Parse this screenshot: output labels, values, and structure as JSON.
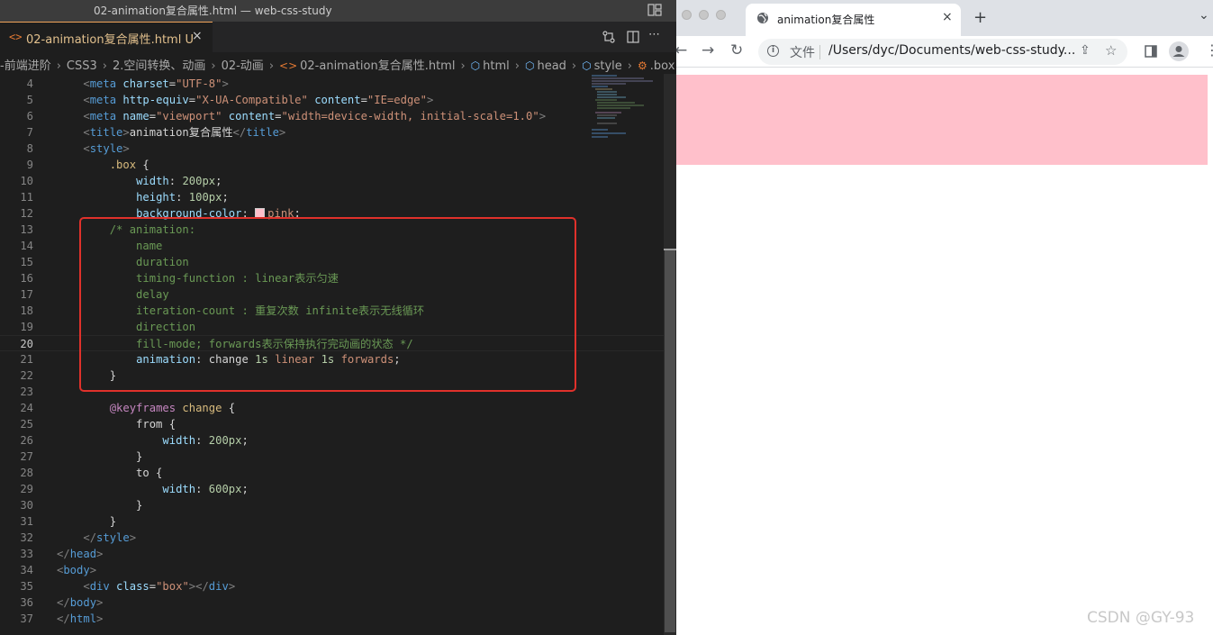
{
  "vscode": {
    "window_title": "02-animation复合属性.html — web-css-study",
    "tab": {
      "icon": "<>",
      "name": "02-animation复合属性.html",
      "status": "U",
      "close": "×"
    },
    "breadcrumb": [
      "-前端进阶",
      "CSS3",
      "2.空间转换、动画",
      "02-动画",
      "02-animation复合属性.html",
      "html",
      "head",
      "style",
      ".box"
    ],
    "code_lines": [
      {
        "n": "4",
        "code": [
          [
            "    ",
            "txt"
          ],
          [
            "<",
            "tg"
          ],
          [
            "meta",
            "tn"
          ],
          [
            " charset",
            "an"
          ],
          [
            "=",
            "txt"
          ],
          [
            "\"UTF-8\"",
            "av"
          ],
          [
            ">",
            "tg"
          ]
        ]
      },
      {
        "n": "5",
        "code": [
          [
            "    ",
            "txt"
          ],
          [
            "<",
            "tg"
          ],
          [
            "meta",
            "tn"
          ],
          [
            " http-equiv",
            "an"
          ],
          [
            "=",
            "txt"
          ],
          [
            "\"X-UA-Compatible\"",
            "av"
          ],
          [
            " content",
            "an"
          ],
          [
            "=",
            "txt"
          ],
          [
            "\"IE=edge\"",
            "av"
          ],
          [
            ">",
            "tg"
          ]
        ]
      },
      {
        "n": "6",
        "code": [
          [
            "    ",
            "txt"
          ],
          [
            "<",
            "tg"
          ],
          [
            "meta",
            "tn"
          ],
          [
            " name",
            "an"
          ],
          [
            "=",
            "txt"
          ],
          [
            "\"viewport\"",
            "av"
          ],
          [
            " content",
            "an"
          ],
          [
            "=",
            "txt"
          ],
          [
            "\"width=device-width, initial-scale=1.0\"",
            "av"
          ],
          [
            ">",
            "tg"
          ]
        ]
      },
      {
        "n": "7",
        "code": [
          [
            "    ",
            "txt"
          ],
          [
            "<",
            "tg"
          ],
          [
            "title",
            "tn"
          ],
          [
            ">",
            "tg"
          ],
          [
            "animation复合属性",
            "txt"
          ],
          [
            "</",
            "tg"
          ],
          [
            "title",
            "tn"
          ],
          [
            ">",
            "tg"
          ]
        ]
      },
      {
        "n": "8",
        "code": [
          [
            "    ",
            "txt"
          ],
          [
            "<",
            "tg"
          ],
          [
            "style",
            "tn"
          ],
          [
            ">",
            "tg"
          ]
        ]
      },
      {
        "n": "9",
        "code": [
          [
            "        ",
            "txt"
          ],
          [
            ".box",
            "sel"
          ],
          [
            " {",
            "txt"
          ]
        ]
      },
      {
        "n": "10",
        "code": [
          [
            "            ",
            "txt"
          ],
          [
            "width",
            "prop"
          ],
          [
            ": ",
            "txt"
          ],
          [
            "200px",
            "num"
          ],
          [
            ";",
            "txt"
          ]
        ]
      },
      {
        "n": "11",
        "code": [
          [
            "            ",
            "txt"
          ],
          [
            "height",
            "prop"
          ],
          [
            ": ",
            "txt"
          ],
          [
            "100px",
            "num"
          ],
          [
            ";",
            "txt"
          ]
        ]
      },
      {
        "n": "12",
        "code": [
          [
            "            ",
            "txt"
          ],
          [
            "background-color",
            "prop"
          ],
          [
            ": ",
            "txt"
          ],
          [
            "SWATCH",
            "swatch"
          ],
          [
            "pink",
            "av"
          ],
          [
            ";",
            "txt"
          ]
        ]
      },
      {
        "n": "13",
        "code": [
          [
            "        ",
            "txt"
          ],
          [
            "/* animation:",
            "cm"
          ]
        ]
      },
      {
        "n": "14",
        "code": [
          [
            "            name",
            "cm"
          ]
        ]
      },
      {
        "n": "15",
        "code": [
          [
            "            duration",
            "cm"
          ]
        ]
      },
      {
        "n": "16",
        "code": [
          [
            "            timing-function : linear表示匀速",
            "cm"
          ]
        ]
      },
      {
        "n": "17",
        "code": [
          [
            "            delay",
            "cm"
          ]
        ]
      },
      {
        "n": "18",
        "code": [
          [
            "            iteration-count : 重复次数 infinite表示无线循环",
            "cm"
          ]
        ]
      },
      {
        "n": "19",
        "code": [
          [
            "            direction",
            "cm"
          ]
        ]
      },
      {
        "n": "20",
        "code": [
          [
            "            fill-mode; forwards表示保持执行完动画的状态 */",
            "cm"
          ]
        ],
        "current": true
      },
      {
        "n": "21",
        "code": [
          [
            "            ",
            "txt"
          ],
          [
            "animation",
            "prop"
          ],
          [
            ": change ",
            "txt"
          ],
          [
            "1s",
            "num"
          ],
          [
            " ",
            "txt"
          ],
          [
            "linear",
            "av"
          ],
          [
            " ",
            "txt"
          ],
          [
            "1s",
            "num"
          ],
          [
            " ",
            "txt"
          ],
          [
            "forwards",
            "av"
          ],
          [
            ";",
            "txt"
          ]
        ]
      },
      {
        "n": "22",
        "code": [
          [
            "        }",
            "txt"
          ]
        ]
      },
      {
        "n": "23",
        "code": []
      },
      {
        "n": "24",
        "code": [
          [
            "        ",
            "txt"
          ],
          [
            "@keyframes",
            "kw"
          ],
          [
            " ",
            "txt"
          ],
          [
            "change",
            "sel"
          ],
          [
            " {",
            "txt"
          ]
        ]
      },
      {
        "n": "25",
        "code": [
          [
            "            from {",
            "txt"
          ]
        ]
      },
      {
        "n": "26",
        "code": [
          [
            "                ",
            "txt"
          ],
          [
            "width",
            "prop"
          ],
          [
            ": ",
            "txt"
          ],
          [
            "200px",
            "num"
          ],
          [
            ";",
            "txt"
          ]
        ]
      },
      {
        "n": "27",
        "code": [
          [
            "            }",
            "txt"
          ]
        ]
      },
      {
        "n": "28",
        "code": [
          [
            "            to {",
            "txt"
          ]
        ]
      },
      {
        "n": "29",
        "code": [
          [
            "                ",
            "txt"
          ],
          [
            "width",
            "prop"
          ],
          [
            ": ",
            "txt"
          ],
          [
            "600px",
            "num"
          ],
          [
            ";",
            "txt"
          ]
        ]
      },
      {
        "n": "30",
        "code": [
          [
            "            }",
            "txt"
          ]
        ]
      },
      {
        "n": "31",
        "code": [
          [
            "        }",
            "txt"
          ]
        ]
      },
      {
        "n": "32",
        "code": [
          [
            "    ",
            "txt"
          ],
          [
            "</",
            "tg"
          ],
          [
            "style",
            "tn"
          ],
          [
            ">",
            "tg"
          ]
        ]
      },
      {
        "n": "33",
        "code": [
          [
            "</",
            "tg"
          ],
          [
            "head",
            "tn"
          ],
          [
            ">",
            "tg"
          ]
        ]
      },
      {
        "n": "34",
        "code": [
          [
            "<",
            "tg"
          ],
          [
            "body",
            "tn"
          ],
          [
            ">",
            "tg"
          ]
        ]
      },
      {
        "n": "35",
        "code": [
          [
            "    ",
            "txt"
          ],
          [
            "<",
            "tg"
          ],
          [
            "div",
            "tn"
          ],
          [
            " class",
            "an"
          ],
          [
            "=",
            "txt"
          ],
          [
            "\"box\"",
            "av"
          ],
          [
            "></",
            "tg"
          ],
          [
            "div",
            "tn"
          ],
          [
            ">",
            "tg"
          ]
        ]
      },
      {
        "n": "36",
        "code": [
          [
            "</",
            "tg"
          ],
          [
            "body",
            "tn"
          ],
          [
            ">",
            "tg"
          ]
        ]
      },
      {
        "n": "37",
        "code": [
          [
            "</",
            "tg"
          ],
          [
            "html",
            "tn"
          ],
          [
            ">",
            "tg"
          ]
        ]
      }
    ]
  },
  "browser": {
    "tab_title": "animation复合属性",
    "tab_close": "×",
    "new_tab": "+",
    "tab_menu": "⌄",
    "scheme_label": "文件",
    "url": "/Users/dyc/Documents/web-css-study...",
    "pink_color": "#ffc0cb"
  },
  "watermark": "CSDN @GY-93"
}
